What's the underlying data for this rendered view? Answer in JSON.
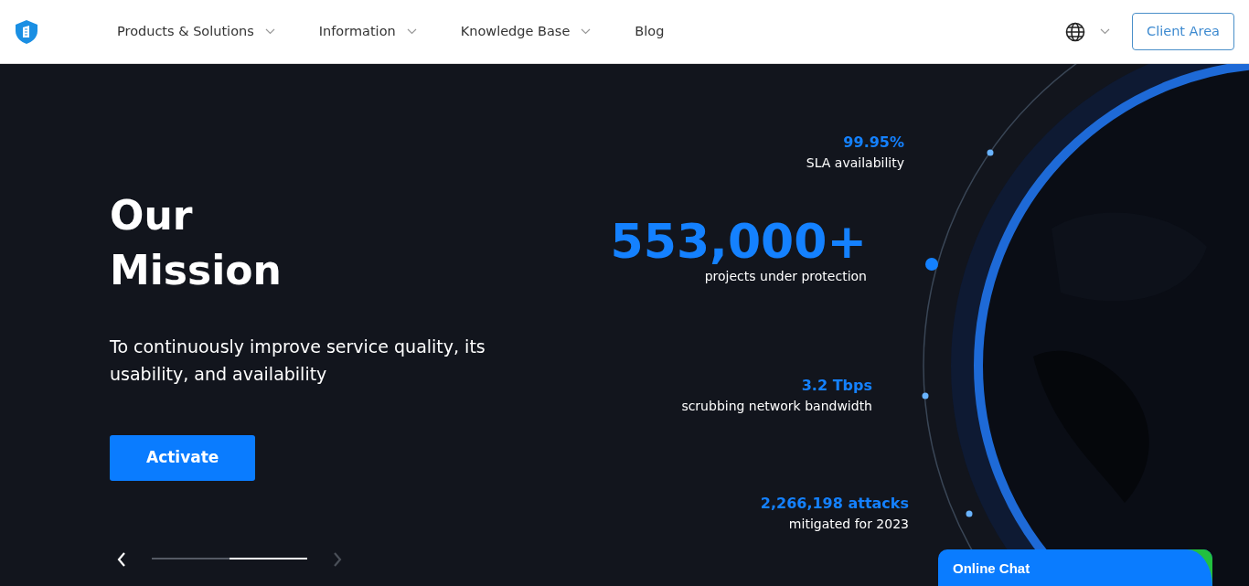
{
  "nav": {
    "items": [
      {
        "label": "Products & Solutions",
        "dropdown": true
      },
      {
        "label": "Information",
        "dropdown": true
      },
      {
        "label": "Knowledge Base",
        "dropdown": true
      },
      {
        "label": "Blog",
        "dropdown": false
      }
    ],
    "client_button": "Client Area"
  },
  "hero": {
    "title_lines": [
      "Our",
      "Mission"
    ],
    "subtitle": "To continuously improve service quality, its usability, and availability",
    "button": "Activate",
    "stats": [
      {
        "value": "99.95%",
        "label": "SLA availability",
        "featured": false
      },
      {
        "value": "553,000+",
        "label": "projects under protection",
        "featured": true
      },
      {
        "value": "3.2 Tbps",
        "label": "scrubbing network bandwidth",
        "featured": false
      },
      {
        "value": "2,266,198 attacks",
        "label": "mitigated for 2023",
        "featured": false
      }
    ],
    "carousel": {
      "prev_disabled": false,
      "next_disabled": true,
      "segments": [
        {
          "selected": false
        },
        {
          "selected": true
        }
      ]
    }
  },
  "chat": {
    "title": "Online Chat"
  }
}
